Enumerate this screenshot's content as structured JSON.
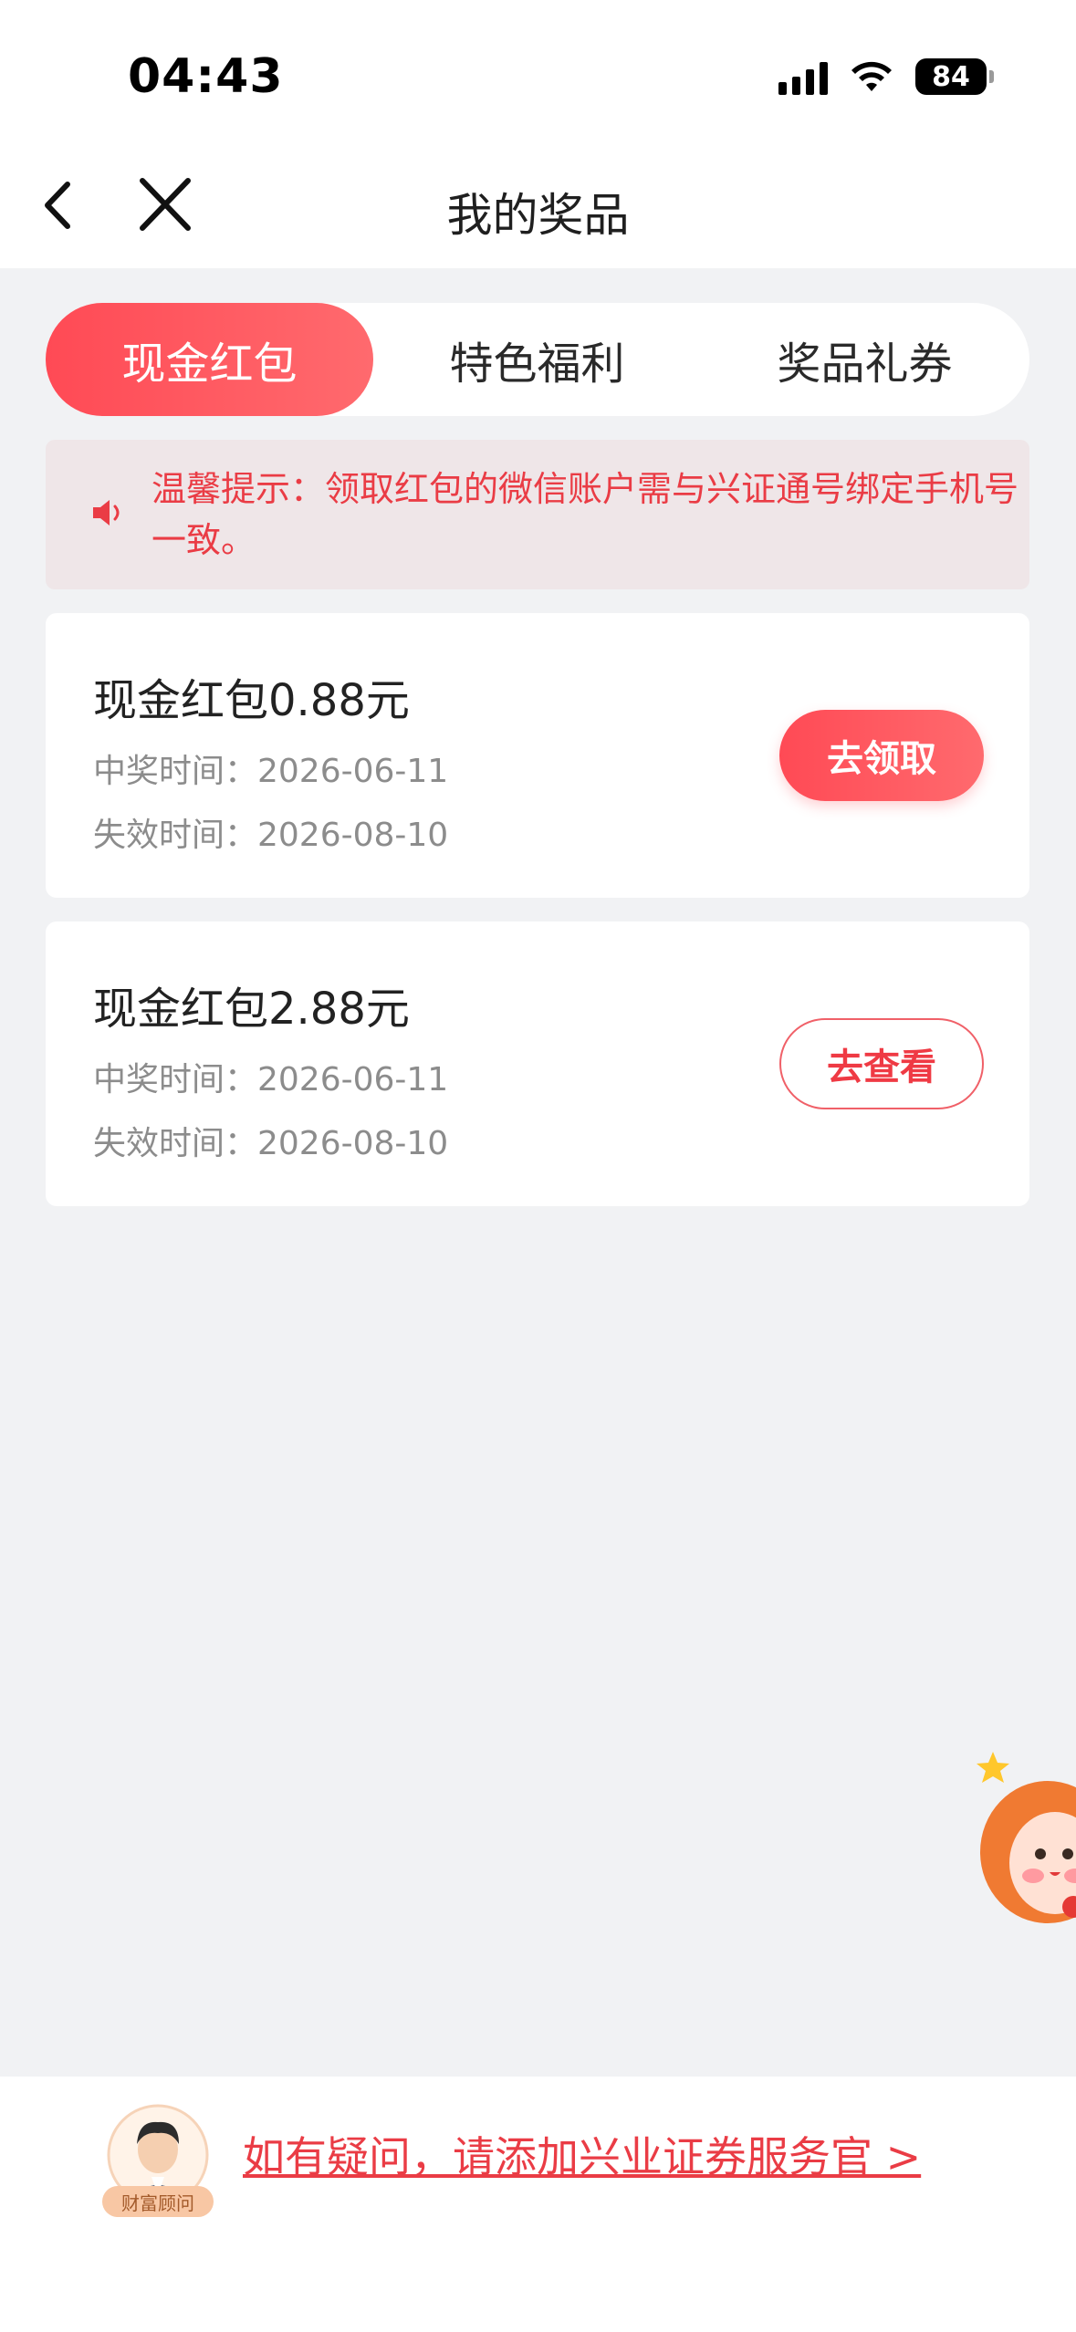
{
  "status_bar": {
    "time": "04:43",
    "battery": "84"
  },
  "nav": {
    "title": "我的奖品"
  },
  "tabs": [
    {
      "label": "现金红包",
      "active": true
    },
    {
      "label": "特色福利",
      "active": false
    },
    {
      "label": "奖品礼券",
      "active": false
    }
  ],
  "notice": {
    "text": "温馨提示：领取红包的微信账户需与兴证通号绑定手机号一致。"
  },
  "prizes": [
    {
      "title": "现金红包0.88元",
      "win_time": "中奖时间：2026-06-11",
      "expire_time": "失效时间：2026-08-10",
      "button": "去领取"
    },
    {
      "title": "现金红包2.88元",
      "win_time": "中奖时间：2026-06-11",
      "expire_time": "失效时间：2026-08-10",
      "button": "去查看"
    }
  ],
  "bottom": {
    "advisor_badge": "财富顾问",
    "link_text": "如有疑问，请添加兴业证券服务官 >"
  },
  "colors": {
    "accent": "#ff4a55",
    "notice_bg": "#efe6e8",
    "page_bg": "#f1f2f4"
  }
}
